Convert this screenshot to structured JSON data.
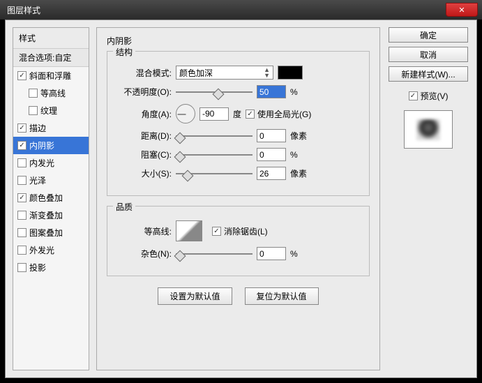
{
  "window": {
    "title": "图层样式"
  },
  "sidebar": {
    "header": "样式",
    "sub": "混合选项:自定",
    "items": [
      {
        "label": "斜面和浮雕",
        "checked": true,
        "indent": false
      },
      {
        "label": "等高线",
        "checked": false,
        "indent": true
      },
      {
        "label": "纹理",
        "checked": false,
        "indent": true
      },
      {
        "label": "描边",
        "checked": true,
        "indent": false
      },
      {
        "label": "内阴影",
        "checked": true,
        "indent": false,
        "selected": true
      },
      {
        "label": "内发光",
        "checked": false,
        "indent": false
      },
      {
        "label": "光泽",
        "checked": false,
        "indent": false
      },
      {
        "label": "颜色叠加",
        "checked": true,
        "indent": false
      },
      {
        "label": "渐变叠加",
        "checked": false,
        "indent": false
      },
      {
        "label": "图案叠加",
        "checked": false,
        "indent": false
      },
      {
        "label": "外发光",
        "checked": false,
        "indent": false
      },
      {
        "label": "投影",
        "checked": false,
        "indent": false
      }
    ]
  },
  "main": {
    "title": "内阴影",
    "structure": {
      "title": "结构",
      "blend_label": "混合模式:",
      "blend_value": "颜色加深",
      "opacity_label": "不透明度(O):",
      "opacity_value": "50",
      "opacity_unit": "%",
      "angle_label": "角度(A):",
      "angle_value": "-90",
      "angle_unit": "度",
      "global_light_label": "使用全局光(G)",
      "global_light_checked": true,
      "distance_label": "距离(D):",
      "distance_value": "0",
      "distance_unit": "像素",
      "choke_label": "阻塞(C):",
      "choke_value": "0",
      "choke_unit": "%",
      "size_label": "大小(S):",
      "size_value": "26",
      "size_unit": "像素"
    },
    "quality": {
      "title": "品质",
      "contour_label": "等高线:",
      "antialias_label": "消除锯齿(L)",
      "antialias_checked": true,
      "noise_label": "杂色(N):",
      "noise_value": "0",
      "noise_unit": "%"
    },
    "default_btn": "设置为默认值",
    "reset_btn": "复位为默认值"
  },
  "right": {
    "ok": "确定",
    "cancel": "取消",
    "new_style": "新建样式(W)...",
    "preview_label": "预览(V)",
    "preview_checked": true
  }
}
